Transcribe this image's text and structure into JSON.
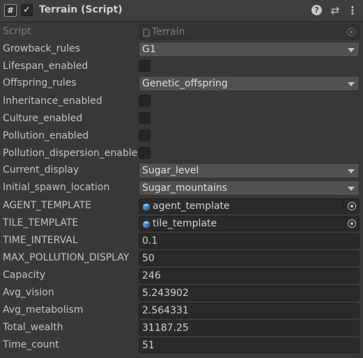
{
  "header": {
    "title": "Terrain (Script)",
    "enabled_check": "✓",
    "script_icon": "#",
    "icons": [
      "script-icon",
      "help-icon",
      "preset-icon",
      "context-menu-icon"
    ]
  },
  "fields": {
    "script": {
      "label": "Script",
      "value": "Terrain"
    },
    "growback_rules": {
      "label": "Growback_rules",
      "value": "G1"
    },
    "lifespan_enabled": {
      "label": "Lifespan_enabled",
      "checked": false
    },
    "offspring_rules": {
      "label": "Offspring_rules",
      "value": "Genetic_offspring"
    },
    "inheritance_enabled": {
      "label": "Inheritance_enabled",
      "checked": false
    },
    "culture_enabled": {
      "label": "Culture_enabled",
      "checked": false
    },
    "pollution_enabled": {
      "label": "Pollution_enabled",
      "checked": false
    },
    "pollution_dispersion_enabled": {
      "label": "Pollution_dispersion_enable",
      "checked": false
    },
    "current_display": {
      "label": "Current_display",
      "value": "Sugar_level"
    },
    "initial_spawn_location": {
      "label": "Initial_spawn_location",
      "value": "Sugar_mountains"
    },
    "agent_template": {
      "label": "AGENT_TEMPLATE",
      "value": "agent_template"
    },
    "tile_template": {
      "label": "TILE_TEMPLATE",
      "value": "tile_template"
    },
    "time_interval": {
      "label": "TIME_INTERVAL",
      "value": "0.1"
    },
    "max_pollution_display": {
      "label": "MAX_POLLUTION_DISPLAY",
      "value": "50"
    },
    "capacity": {
      "label": "Capacity",
      "value": "246"
    },
    "avg_vision": {
      "label": "Avg_vision",
      "value": "5.243902"
    },
    "avg_metabolism": {
      "label": "Avg_metabolism",
      "value": "2.564331"
    },
    "total_wealth": {
      "label": "Total_wealth",
      "value": "31187.25"
    },
    "time_count": {
      "label": "Time_count",
      "value": "51"
    }
  },
  "colors": {
    "background": "#383838",
    "field": "#2a2a2a",
    "dropdown": "#515151",
    "prefab_icon": "#4fa3e6"
  }
}
